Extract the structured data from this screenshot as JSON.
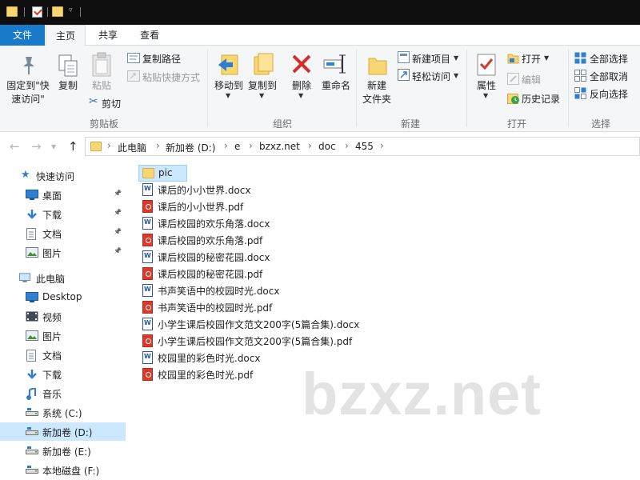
{
  "ribbon_tabs": {
    "file": "文件",
    "home": "主页",
    "share": "共享",
    "view": "查看"
  },
  "ribbon": {
    "clipboard": {
      "group_label": "剪贴板",
      "pin_label_1": "固定到\"快",
      "pin_label_2": "速访问\"",
      "copy": "复制",
      "paste": "粘贴",
      "copy_path": "复制路径",
      "paste_shortcut": "粘贴快捷方式",
      "cut": "剪切"
    },
    "organize": {
      "group_label": "组织",
      "move_to": "移动到",
      "copy_to": "复制到",
      "delete": "删除",
      "rename": "重命名"
    },
    "new": {
      "group_label": "新建",
      "new_folder_1": "新建",
      "new_folder_2": "文件夹",
      "new_item": "新建项目",
      "easy_access": "轻松访问"
    },
    "open": {
      "group_label": "打开",
      "properties": "属性",
      "open": "打开",
      "edit": "编辑",
      "history": "历史记录"
    },
    "select": {
      "group_label": "选择",
      "select_all": "全部选择",
      "select_none": "全部取消",
      "invert": "反向选择"
    }
  },
  "breadcrumb": [
    "此电脑",
    "新加卷 (D:)",
    "e",
    "bzxz.net",
    "doc",
    "455"
  ],
  "sidebar": {
    "quick_access": "快速访问",
    "quick_items": [
      {
        "label": "桌面",
        "icon": "desktop-icon"
      },
      {
        "label": "下载",
        "icon": "download-icon"
      },
      {
        "label": "文档",
        "icon": "document-icon"
      },
      {
        "label": "图片",
        "icon": "picture-icon"
      }
    ],
    "this_pc": "此电脑",
    "pc_items": [
      {
        "label": "Desktop",
        "icon": "desktop-icon"
      },
      {
        "label": "视频",
        "icon": "video-icon"
      },
      {
        "label": "图片",
        "icon": "picture-icon"
      },
      {
        "label": "文档",
        "icon": "document-icon"
      },
      {
        "label": "下载",
        "icon": "download-icon"
      },
      {
        "label": "音乐",
        "icon": "music-icon"
      },
      {
        "label": "系统 (C:)",
        "icon": "drive-icon"
      },
      {
        "label": "新加卷 (D:)",
        "icon": "drive-icon",
        "selected": true
      },
      {
        "label": "新加卷 (E:)",
        "icon": "drive-icon"
      },
      {
        "label": "本地磁盘 (F:)",
        "icon": "drive-icon"
      }
    ]
  },
  "files": [
    {
      "name": "pic",
      "type": "folder",
      "selected": true
    },
    {
      "name": "课后的小小世界.docx",
      "type": "docx"
    },
    {
      "name": "课后的小小世界.pdf",
      "type": "pdf"
    },
    {
      "name": "课后校园的欢乐角落.docx",
      "type": "docx"
    },
    {
      "name": "课后校园的欢乐角落.pdf",
      "type": "pdf"
    },
    {
      "name": "课后校园的秘密花园.docx",
      "type": "docx"
    },
    {
      "name": "课后校园的秘密花园.pdf",
      "type": "pdf"
    },
    {
      "name": "书声笑语中的校园时光.docx",
      "type": "docx"
    },
    {
      "name": "书声笑语中的校园时光.pdf",
      "type": "pdf"
    },
    {
      "name": "小学生课后校园作文范文200字(5篇合集).docx",
      "type": "docx"
    },
    {
      "name": "小学生课后校园作文范文200字(5篇合集).pdf",
      "type": "pdf"
    },
    {
      "name": "校园里的彩色时光.docx",
      "type": "docx"
    },
    {
      "name": "校园里的彩色时光.pdf",
      "type": "pdf"
    }
  ],
  "watermark": "bzxz.net",
  "colors": {
    "accent": "#1979ca",
    "selection": "#cce8ff",
    "folder": "#f7d774",
    "pdf": "#d93a2b",
    "word": "#2b579a"
  }
}
